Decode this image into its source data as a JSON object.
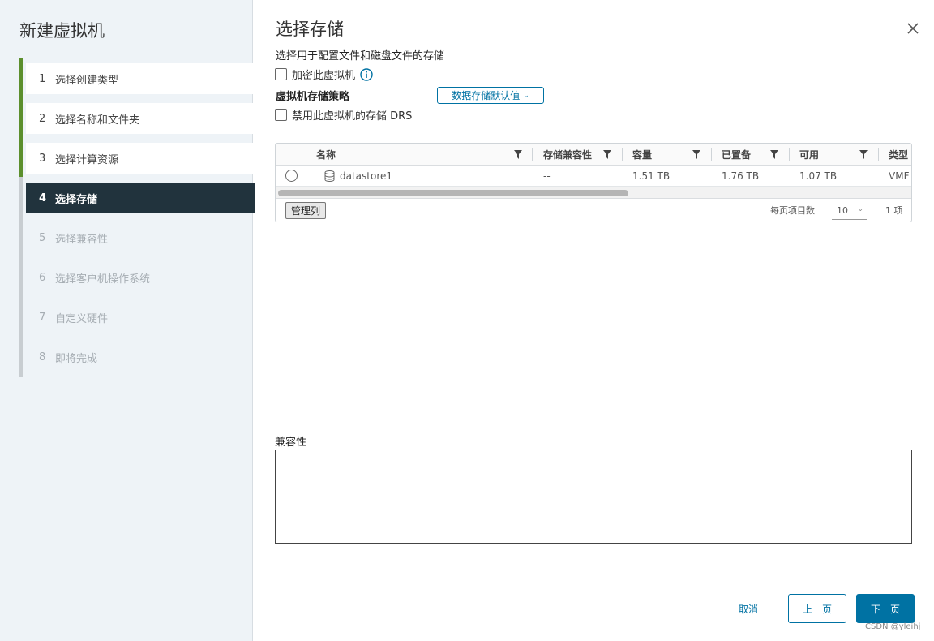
{
  "sidebar": {
    "title": "新建虚拟机",
    "steps": [
      {
        "num": "1",
        "label": "选择创建类型",
        "state": "done"
      },
      {
        "num": "2",
        "label": "选择名称和文件夹",
        "state": "done"
      },
      {
        "num": "3",
        "label": "选择计算资源",
        "state": "done"
      },
      {
        "num": "4",
        "label": "选择存储",
        "state": "active"
      },
      {
        "num": "5",
        "label": "选择兼容性",
        "state": "pending"
      },
      {
        "num": "6",
        "label": "选择客户机操作系统",
        "state": "pending"
      },
      {
        "num": "7",
        "label": "自定义硬件",
        "state": "pending"
      },
      {
        "num": "8",
        "label": "即将完成",
        "state": "pending"
      }
    ]
  },
  "main": {
    "title": "选择存储",
    "subtitle": "选择用于配置文件和磁盘文件的存储",
    "encrypt_label": "加密此虚拟机",
    "policy_label": "虚拟机存储策略",
    "policy_value": "数据存储默认值",
    "disable_drs_label": "禁用此虚拟机的存储 DRS",
    "grid": {
      "columns": [
        "名称",
        "存储兼容性",
        "容量",
        "已置备",
        "可用",
        "类型"
      ],
      "rows": [
        {
          "name": "datastore1",
          "compat": "--",
          "capacity": "1.51 TB",
          "provisioned": "1.76 TB",
          "free": "1.07 TB",
          "type": "VMF"
        }
      ],
      "manage_columns": "管理列",
      "per_page_label": "每页项目数",
      "per_page_value": "10",
      "count_label": "1 项"
    },
    "compat_label": "兼容性"
  },
  "footer": {
    "cancel": "取消",
    "back": "上一页",
    "next": "下一页"
  },
  "watermark": "CSDN @yleihj",
  "colors": {
    "accent": "#0072a3",
    "active_step_bg": "#21333d",
    "done_bar": "#5c8f2d",
    "sidebar_bg": "#eef3f7"
  }
}
